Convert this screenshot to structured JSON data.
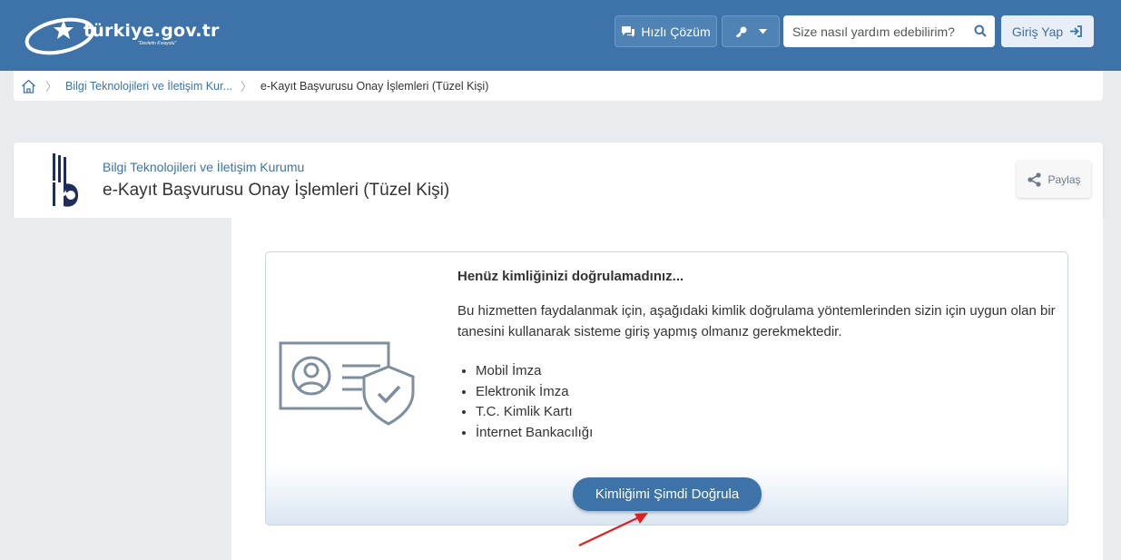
{
  "header": {
    "logo_text": "türkiye.gov.tr",
    "logo_tagline": "\"Devletin Kısayolu\"",
    "quick_solution_label": "Hızlı Çözüm",
    "search_placeholder": "Size nasıl yardım edebilirim?",
    "login_label": "Giriş Yap",
    "bg_color": "#3d73a8"
  },
  "breadcrumb": {
    "items": [
      {
        "label": "Bilgi Teknolojileri ve İletişim Kur..."
      },
      {
        "label": "e-Kayıt Başvurusu Onay İşlemleri (Tüzel Kişi)"
      }
    ]
  },
  "service": {
    "org_name": "Bilgi Teknolojileri ve İletişim Kurumu",
    "title": "e-Kayıt Başvurusu Onay İşlemleri (Tüzel Kişi)",
    "share_label": "Paylaş"
  },
  "notice": {
    "title": "Henüz kimliğinizi doğrulamadınız...",
    "text": "Bu hizmetten faydalanmak için, aşağıdaki kimlik doğrulama yöntemlerinden sizin için uygun olan bir tanesini kullanarak sisteme giriş yapmış olmanız gerekmektedir.",
    "methods": [
      "Mobil İmza",
      "Elektronik İmza",
      "T.C. Kimlik Kartı",
      "İnternet Bankacılığı"
    ],
    "verify_button": "Kimliğimi Şimdi Doğrula"
  },
  "icons": [
    "home-icon",
    "chat-icon",
    "key-icon",
    "chevron-down-icon",
    "search-icon",
    "login-arrow-icon",
    "share-icon",
    "id-card-shield-icon",
    "annotation-arrow"
  ]
}
